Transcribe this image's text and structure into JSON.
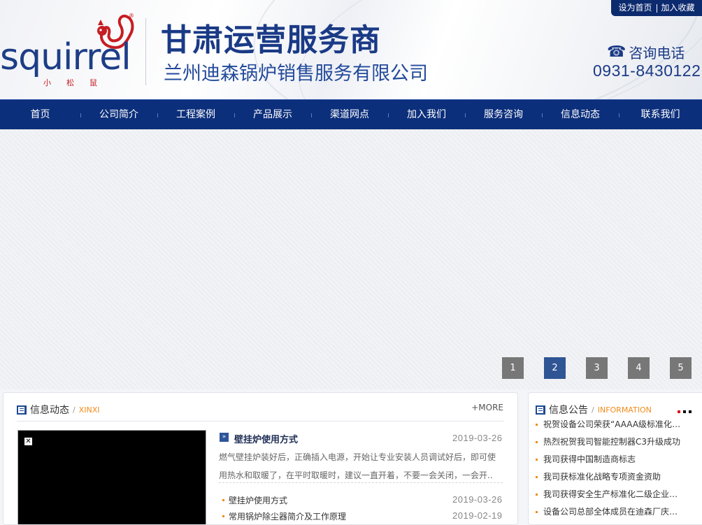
{
  "topbar": {
    "set_home": "设为首页",
    "add_favorite": "加入收藏"
  },
  "logo": {
    "word": "squirrel",
    "cn": "小松鼠",
    "reg": "®"
  },
  "header": {
    "title": "甘肃运营服务商",
    "subtitle": "兰州迪森锅炉销售服务有限公司",
    "hotline_label": "咨询电话",
    "hotline_number": "0931-8430122",
    "phone_icon": "phone-icon"
  },
  "nav": {
    "items": [
      {
        "label": "首页"
      },
      {
        "label": "公司简介"
      },
      {
        "label": "工程案例"
      },
      {
        "label": "产品展示"
      },
      {
        "label": "渠道网点"
      },
      {
        "label": "加入我们"
      },
      {
        "label": "服务咨询"
      },
      {
        "label": "信息动态"
      },
      {
        "label": "联系我们"
      }
    ],
    "bg_color": "#0c2f7b"
  },
  "banner": {
    "pages": [
      "1",
      "2",
      "3",
      "4",
      "5"
    ],
    "active_page": "2",
    "active_color": "#2f5595",
    "inactive_color": "#777777"
  },
  "news": {
    "title": "信息动态",
    "title_en": "XINXI",
    "more": "+MORE",
    "featured": {
      "title": "壁挂炉使用方式",
      "date": "2019-03-26",
      "desc": "燃气壁挂炉装好后，正确插入电源，开始让专业安装人员调试好后，即可使用热水和取暖了，在平时取暖时，建议一直开着，不要一会关闭，一会开.."
    },
    "items": [
      {
        "title": "壁挂炉使用方式",
        "date": "2019-03-26"
      },
      {
        "title": "常用锅炉除尘器简介及工作原理",
        "date": "2019-02-19"
      }
    ]
  },
  "notice": {
    "title": "信息公告",
    "title_en": "INFORMATION",
    "items": [
      {
        "title": "祝贺设备公司荣获“AAAA级标准化良好行为企业”"
      },
      {
        "title": "热烈祝贺我司智能控制器C3升级成功"
      },
      {
        "title": "我司获得中国制造商标志"
      },
      {
        "title": "我司获标准化战略专项资金资助"
      },
      {
        "title": "我司获得安全生产标准化二级企业认证"
      },
      {
        "title": "设备公司总部全体成员在迪森厂庆活动"
      }
    ]
  },
  "colors": {
    "brand_blue": "#1a3a86",
    "accent_orange": "#f08c1a",
    "logo_red": "#c61d23"
  }
}
